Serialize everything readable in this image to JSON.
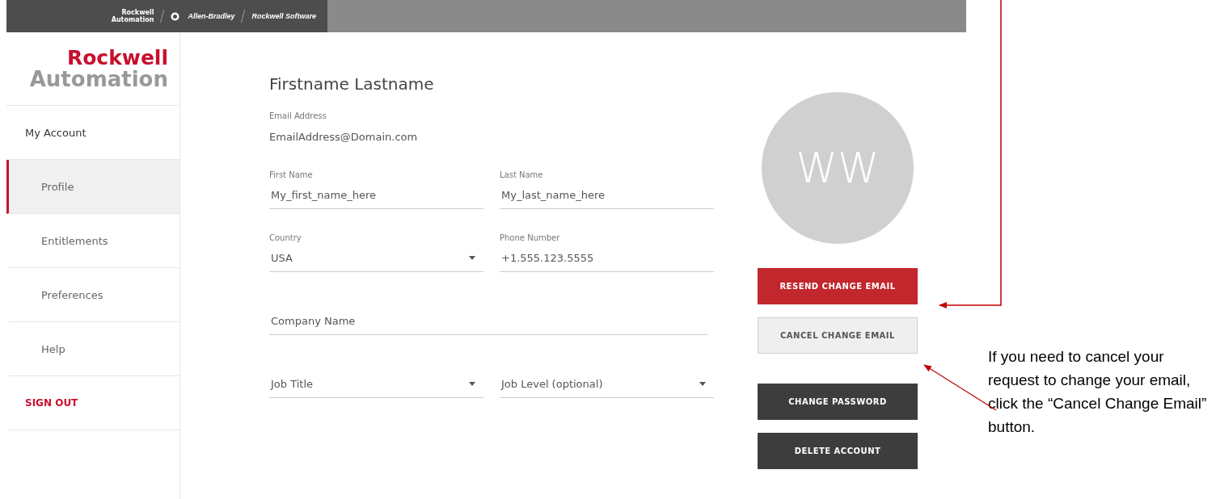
{
  "top_bar": {
    "brand_logo": [
      "Rockwell",
      "Automation"
    ],
    "brands": [
      {
        "label": "Allen-Bradley",
        "kind": "emblem"
      },
      {
        "label": "Rockwell Software",
        "kind": "plain"
      }
    ]
  },
  "sidebar": {
    "logo": [
      "Rockwell",
      "Automation"
    ],
    "items": [
      {
        "label": "My Account",
        "kind": "heading",
        "selected": false
      },
      {
        "label": "Profile",
        "kind": "item",
        "selected": true
      },
      {
        "label": "Entitlements",
        "kind": "item",
        "selected": false
      },
      {
        "label": "Preferences",
        "kind": "item",
        "selected": false
      },
      {
        "label": "Help",
        "kind": "item",
        "selected": false
      },
      {
        "label": "SIGN OUT",
        "kind": "signout",
        "selected": false
      }
    ]
  },
  "profile": {
    "name": "Firstname Lastname",
    "email_label": "Email Address",
    "email": "EmailAddress@Domain.com",
    "rows": [
      [
        {
          "label": "First Name",
          "value": "My_first_name_here",
          "kind": "text"
        },
        {
          "label": "Last Name",
          "value": "My_last_name_here",
          "kind": "text"
        }
      ],
      [
        {
          "label": "Country",
          "value": "USA",
          "kind": "select"
        },
        {
          "label": "Phone Number",
          "value": "+1.555.123.5555",
          "kind": "text"
        }
      ],
      [
        {
          "placeholder": "Company Name",
          "kind": "text"
        }
      ],
      [
        {
          "placeholder": "Job Title",
          "kind": "select"
        },
        {
          "placeholder": "Job Level (optional)",
          "kind": "select"
        }
      ]
    ]
  },
  "avatar": {
    "initials": "WW"
  },
  "buttons": [
    {
      "label": "RESEND CHANGE EMAIL",
      "kind": "primary"
    },
    {
      "label": "CANCEL CHANGE EMAIL",
      "kind": "secondary"
    },
    {
      "label": "CHANGE PASSWORD",
      "kind": "dark"
    },
    {
      "label": "DELETE ACCOUNT",
      "kind": "dark"
    }
  ],
  "annotation": {
    "text": "If you need to cancel your request to change your email, click the “Cancel Change Email” button."
  }
}
